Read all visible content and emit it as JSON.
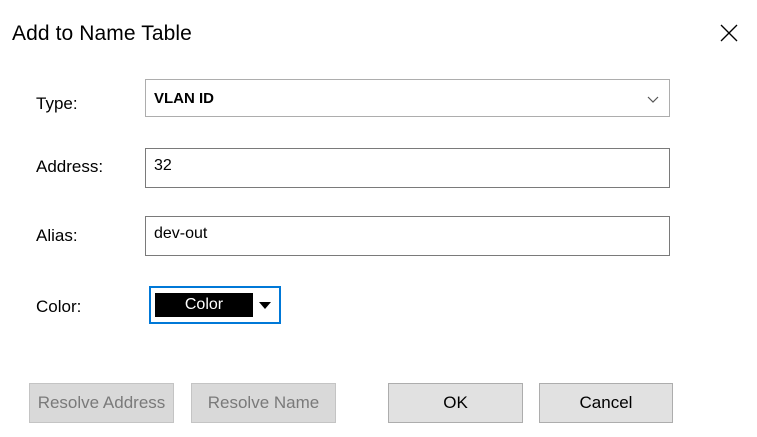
{
  "dialog": {
    "title": "Add to Name Table"
  },
  "form": {
    "type": {
      "label": "Type:",
      "value": "VLAN ID"
    },
    "address": {
      "label": "Address:",
      "value": "32"
    },
    "alias": {
      "label": "Alias:",
      "value": "dev-out"
    },
    "color": {
      "label": "Color:",
      "value": "Color",
      "swatch_color": "#000000"
    }
  },
  "buttons": {
    "resolve_address": "Resolve Address",
    "resolve_name": "Resolve Name",
    "ok": "OK",
    "cancel": "Cancel"
  },
  "icons": {
    "close": "close-icon",
    "dropdown": "chevron-down-icon",
    "color_dropdown": "triangle-down-icon"
  },
  "colors": {
    "focus_border": "#0078d7",
    "button_face": "#e1e1e1",
    "disabled_text": "#7a7a7a"
  }
}
